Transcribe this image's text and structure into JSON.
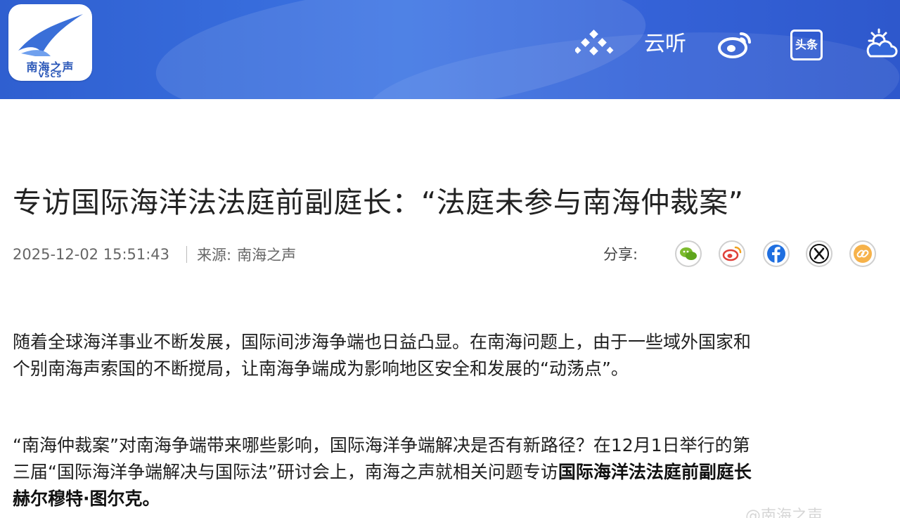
{
  "header": {
    "logo_name": "南海之声",
    "logo_sub": "VSCS",
    "icons": [
      "dots-icon",
      "yunting-icon",
      "weibo-icon",
      "toutiao-icon",
      "weather-icon"
    ],
    "yunting_label": "云听",
    "toutiao_label": "头条",
    "colors": {
      "bar": "#3468da",
      "logo_text": "#2a57b8"
    }
  },
  "article": {
    "title": "专访国际海洋法法庭前副庭长：“法庭未参与南海仲裁案”",
    "date": "2025-12-02 15:51:43",
    "source_label": "来源:",
    "source": "南海之声",
    "share_label": "分享:",
    "share_icons": [
      "wechat-icon",
      "weibo-icon",
      "facebook-icon",
      "x-icon",
      "link-icon"
    ],
    "paragraphs": [
      {
        "line1": "随着全球海洋事业不断发展，国际间涉海争端也日益凸显。在南海问题上，由于一些域外国家和",
        "line2": "个别南海声索国的不断搅局，让南海争端成为影响地区安全和发展的“动荡点”。"
      },
      {
        "line1": "“南海仲裁案”对南海争端带来哪些影响，国际海洋争端解决是否有新路径？在12月1日举行的第",
        "line2_text": "三届“国际海洋争端解决与国际法”研讨会上，南海之声就相关问题专访",
        "line2_bold": "国际海洋法法庭前副庭长",
        "line3_bold": "赫尔穆特·图尔克。"
      }
    ]
  },
  "watermark": "@南海之声"
}
